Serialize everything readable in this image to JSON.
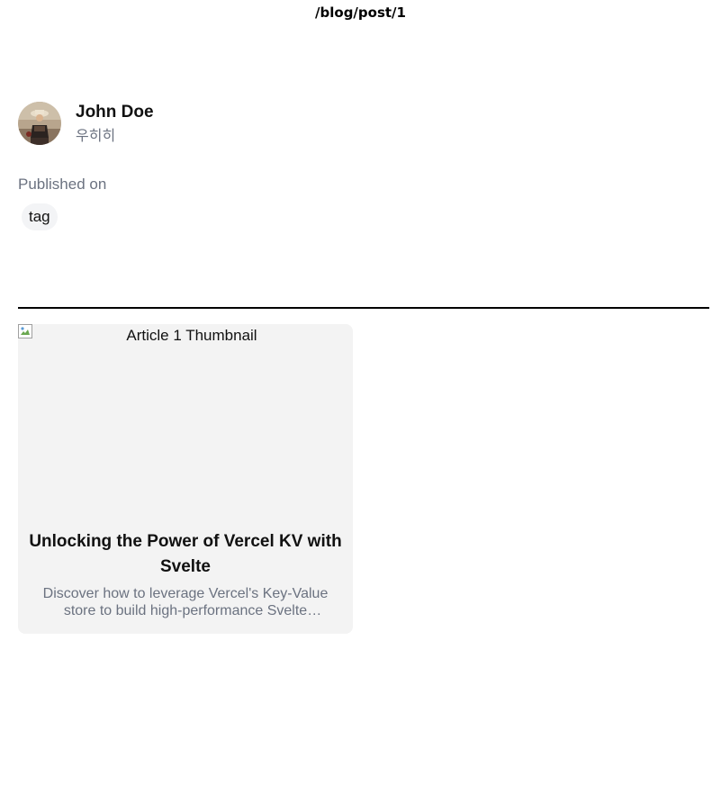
{
  "url": "/blog/post/1",
  "author": {
    "name": "John Doe",
    "bio": "우히히",
    "avatar_icon": "author-avatar-photo"
  },
  "published_label": "Published on",
  "tags": [
    "tag"
  ],
  "articles": [
    {
      "thumbnail_alt": "Article 1 Thumbnail",
      "title": "Unlocking the Power of Vercel KV with Svelte",
      "description": "Discover how to leverage Vercel's Key-Value store to build high-performance Svelte applications."
    }
  ],
  "colors": {
    "card_background": "#f3f3f3",
    "tag_background": "#f3f4f6",
    "muted_text": "#6b7280",
    "divider": "#000000"
  }
}
